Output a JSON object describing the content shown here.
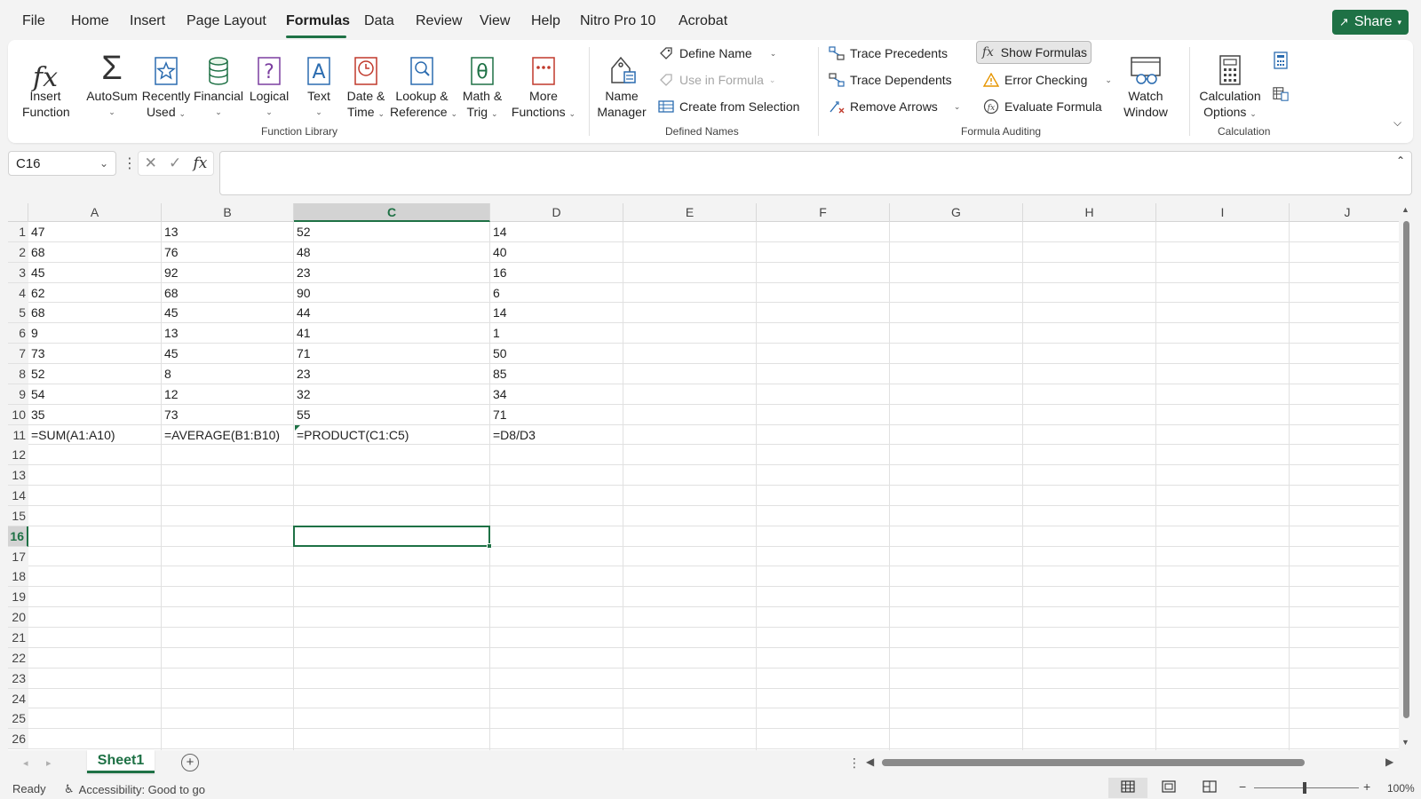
{
  "menu": {
    "tabs": [
      "File",
      "Home",
      "Insert",
      "Page Layout",
      "Formulas",
      "Data",
      "Review",
      "View",
      "Help",
      "Nitro Pro 10",
      "Acrobat"
    ],
    "active": "Formulas",
    "share_label": "Share"
  },
  "ribbon": {
    "function_library": {
      "label": "Function Library",
      "insert_function": [
        "Insert",
        "Function"
      ],
      "autosum": "AutoSum",
      "recently_used": [
        "Recently",
        "Used"
      ],
      "financial": "Financial",
      "logical": "Logical",
      "text": "Text",
      "date_time": [
        "Date &",
        "Time"
      ],
      "lookup_reference": [
        "Lookup &",
        "Reference"
      ],
      "math_trig": [
        "Math &",
        "Trig"
      ],
      "more_functions": [
        "More",
        "Functions"
      ]
    },
    "defined_names": {
      "label": "Defined Names",
      "name_manager": [
        "Name",
        "Manager"
      ],
      "define_name": "Define Name",
      "use_in_formula": "Use in Formula",
      "create_from_selection": "Create from Selection"
    },
    "formula_auditing": {
      "label": "Formula Auditing",
      "trace_precedents": "Trace Precedents",
      "trace_dependents": "Trace Dependents",
      "remove_arrows": "Remove Arrows",
      "show_formulas": "Show Formulas",
      "error_checking": "Error Checking",
      "evaluate_formula": "Evaluate Formula",
      "watch_window": [
        "Watch",
        "Window"
      ]
    },
    "calculation": {
      "label": "Calculation",
      "calculation_options": [
        "Calculation",
        "Options"
      ]
    }
  },
  "formula_bar": {
    "name_box": "C16",
    "fx_label": "fx",
    "formula": ""
  },
  "sheet": {
    "columns": [
      "A",
      "B",
      "C",
      "D",
      "E",
      "F",
      "G",
      "H",
      "I",
      "J"
    ],
    "selected_column": "C",
    "selected_row": 16,
    "row_count": 26,
    "rows": [
      [
        "47",
        "13",
        "52",
        "14"
      ],
      [
        "68",
        "76",
        "48",
        "40"
      ],
      [
        "45",
        "92",
        "23",
        "16"
      ],
      [
        "62",
        "68",
        "90",
        "6"
      ],
      [
        "68",
        "45",
        "44",
        "14"
      ],
      [
        "9",
        "13",
        "41",
        "1"
      ],
      [
        "73",
        "45",
        "71",
        "50"
      ],
      [
        "52",
        "8",
        "23",
        "85"
      ],
      [
        "54",
        "12",
        "32",
        "34"
      ],
      [
        "35",
        "73",
        "55",
        "71"
      ],
      [
        "=SUM(A1:A10)",
        "=AVERAGE(B1:B10)",
        "=PRODUCT(C1:C5)",
        "=D8/D3"
      ]
    ]
  },
  "tabs": {
    "sheets": [
      "Sheet1"
    ],
    "active": "Sheet1"
  },
  "status": {
    "ready": "Ready",
    "accessibility": "Accessibility: Good to go",
    "zoom": "100%"
  },
  "colors": {
    "accent": "#1e7145",
    "background": "#f3f3f3"
  }
}
